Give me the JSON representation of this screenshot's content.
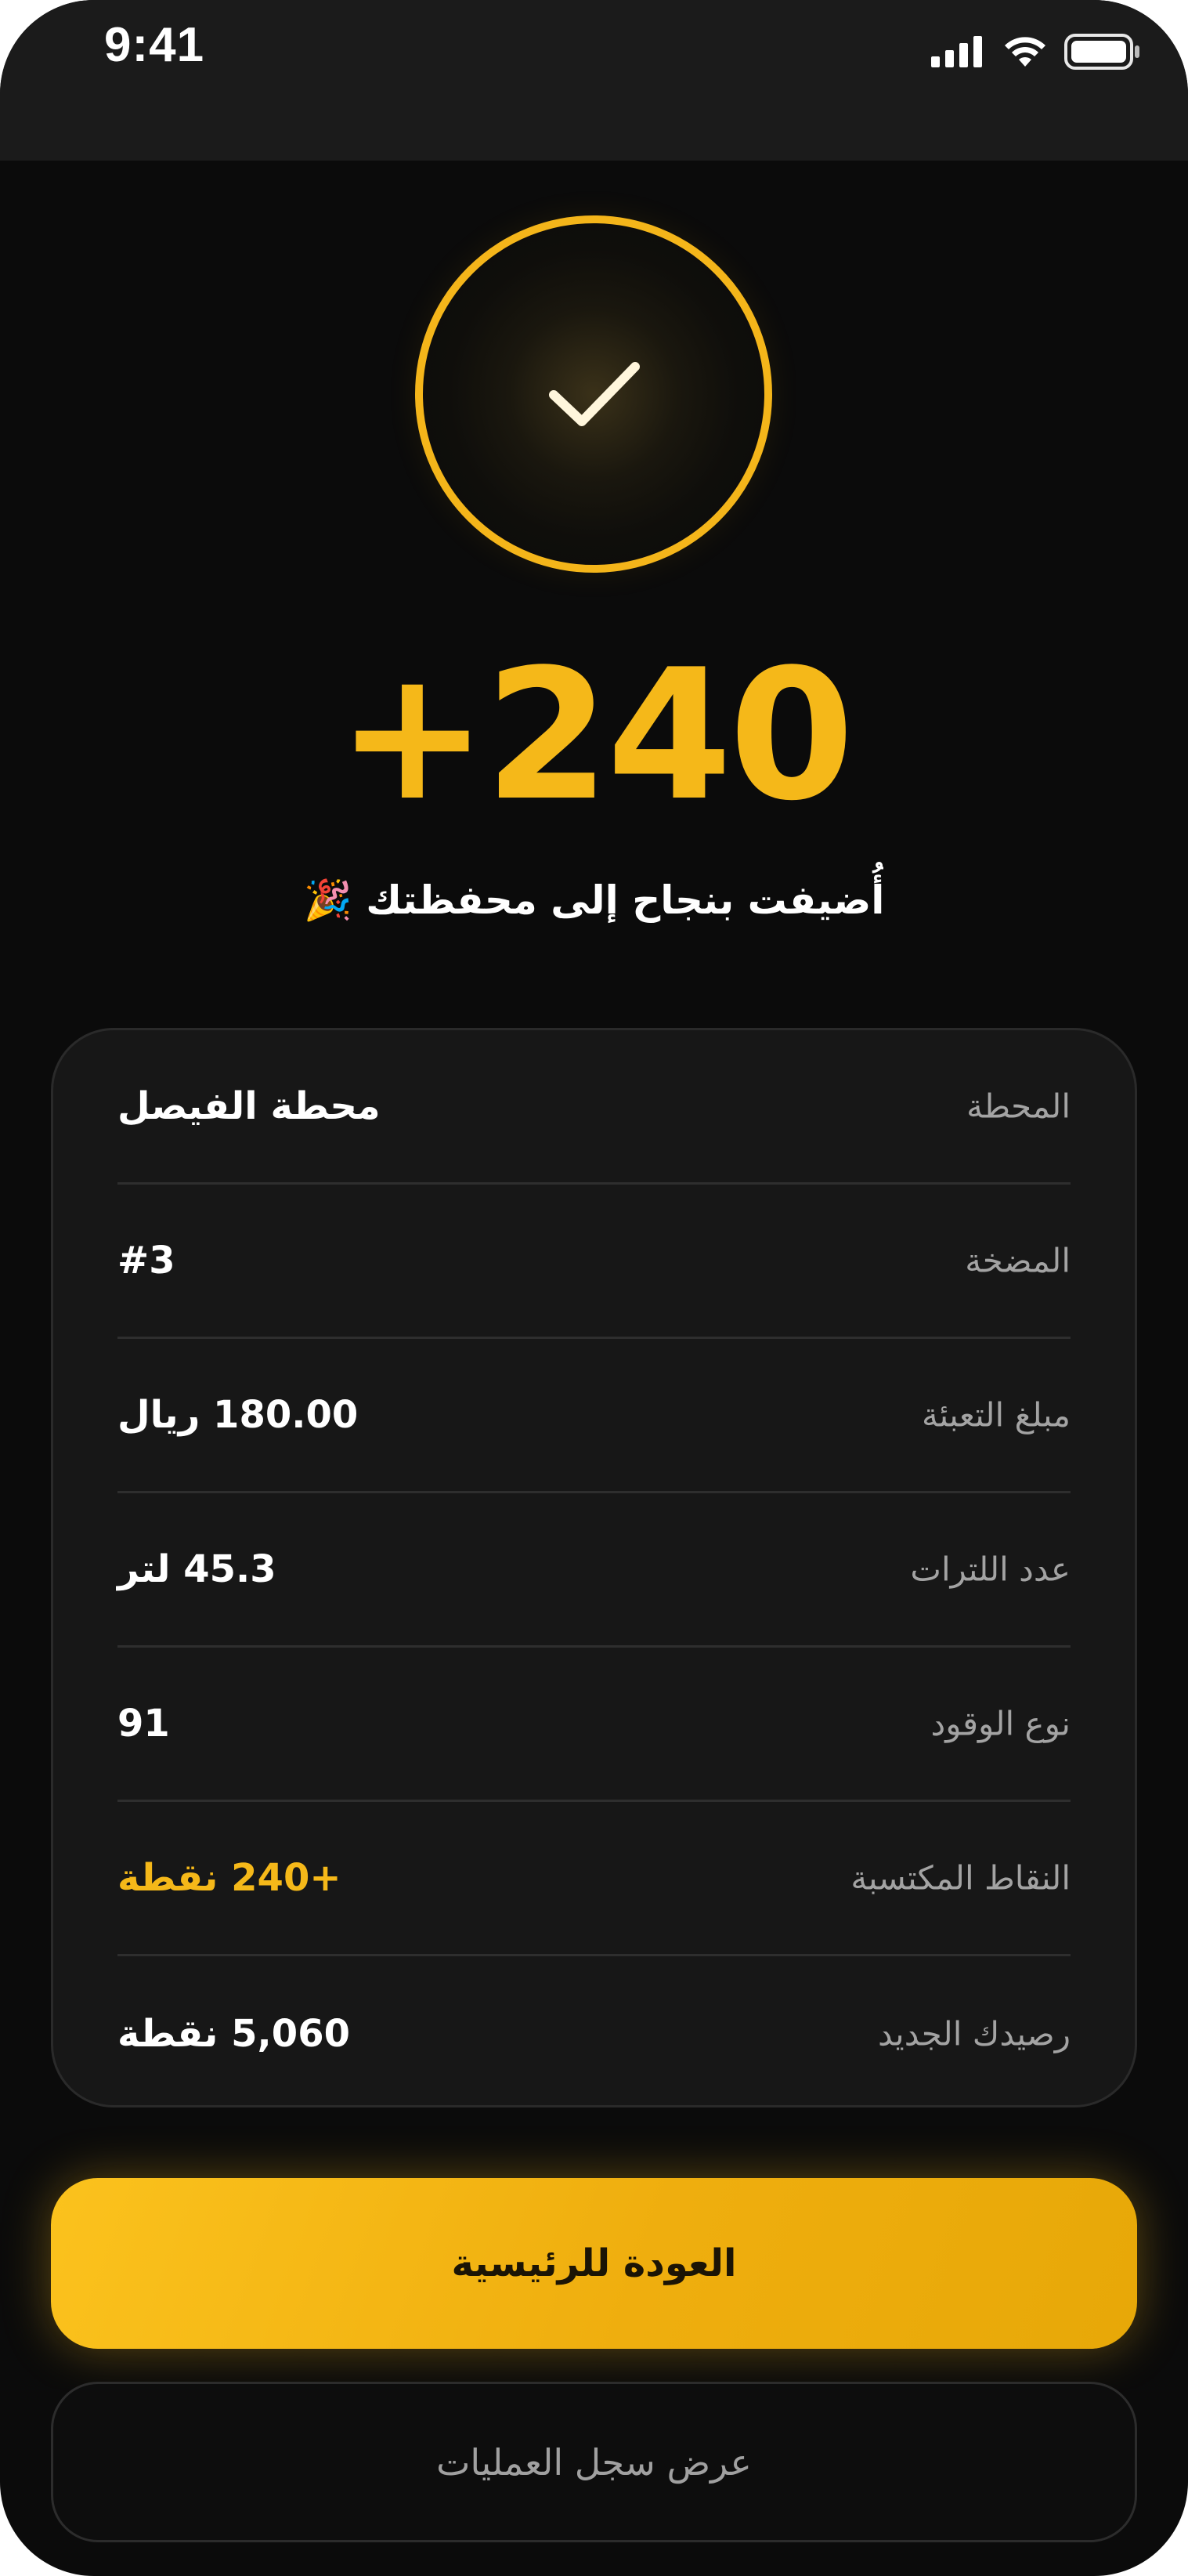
{
  "status_bar": {
    "time": "9:41",
    "icons": [
      "cellular-signal-icon",
      "wifi-icon",
      "battery-icon"
    ]
  },
  "success": {
    "icon": "check-icon",
    "points": "+240",
    "message": "أُضيفت بنجاح إلى محفظتك 🎉"
  },
  "details": {
    "rows": [
      {
        "label": "المحطة",
        "value": "محطة الفيصل"
      },
      {
        "label": "المضخة",
        "value": "#3"
      },
      {
        "label": "مبلغ التعبئة",
        "value": "180.00 ريال"
      },
      {
        "label": "عدد اللترات",
        "value": "45.3 لتر"
      },
      {
        "label": "نوع الوقود",
        "value": "91"
      },
      {
        "label": "النقاط المكتسبة",
        "value": "+240 نقطة"
      },
      {
        "label": "رصيدك الجديد",
        "value": "5,060 نقطة"
      }
    ]
  },
  "actions": {
    "primary_label": "العودة للرئيسية",
    "secondary_label": "عرض سجل العمليات"
  },
  "colors": {
    "accent": "#f5b819",
    "background": "#0b0b0b",
    "card": "#171717",
    "label": "#a3a3a3"
  }
}
